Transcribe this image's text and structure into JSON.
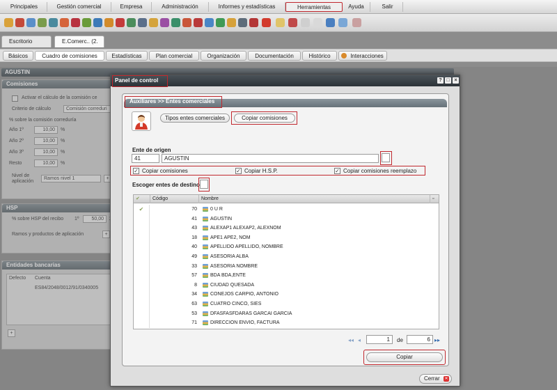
{
  "menu": {
    "items": [
      "Principales",
      "Gestión comercial",
      "Empresa",
      "Administración",
      "Informes y estadísticas",
      "Herramientas",
      "Ayuda",
      "Salir"
    ],
    "highlighted": "Herramientas"
  },
  "toolbar": {
    "icon_count": 31
  },
  "doc_tabs": [
    {
      "label": "Escritorio"
    },
    {
      "label": "E.Comerc.. (2."
    }
  ],
  "sub_tabs": [
    "Básicos",
    "Cuadro de comisiones",
    "Estadísticas",
    "Plan comercial",
    "Organización",
    "Documentación",
    "Histórico",
    "Interacciones"
  ],
  "background": {
    "entity_name": "AGUSTIN",
    "comisiones": {
      "title": "Comisiones",
      "activar_label": "Activar el cálculo de la comisión ce",
      "criterio_label": "Criterio de cálculo",
      "criterio_value": "Comisión correduri",
      "pct_label": "% sobre la comisión correduría",
      "years": [
        {
          "label": "Año 1º",
          "value": "10,00",
          "unit": "%"
        },
        {
          "label": "Año 2º",
          "value": "10,00",
          "unit": "%"
        },
        {
          "label": "Año 3º",
          "value": "10,00",
          "unit": "%"
        },
        {
          "label": "Resto",
          "value": "10,00",
          "unit": "%"
        }
      ],
      "nivel_label_1": "Nivel de",
      "nivel_label_2": "aplicación",
      "nivel_value": "Ramos nivel 1"
    },
    "hsp": {
      "title": "HSP",
      "pct_label": "% sobre HSP del recibo",
      "first_label": "1º",
      "first_value": "50,00",
      "second_label": "2",
      "ramos_label": "Ramos y productos de aplicación"
    },
    "bancos": {
      "title": "Entidades bancarias",
      "col_defecto": "Defecto",
      "col_cuenta": "Cuenta",
      "account": "ES84/2048/0012/91/0340005"
    }
  },
  "modal": {
    "title": "Panel de control",
    "breadcrumb": "Auxiliares >> Entes comerciales",
    "tabs": [
      "Tipos entes comerciales",
      "Copiar comisiones"
    ],
    "active_tab": "Copiar comisiones",
    "origen_label": "Ente de origen",
    "origen_code": "41",
    "origen_name": "AGUSTIN",
    "options": [
      {
        "label": "Copiar comisiones",
        "checked": true
      },
      {
        "label": "Copiar H.S.P.",
        "checked": true
      },
      {
        "label": "Copiar comisiones reemplazo",
        "checked": true
      }
    ],
    "destino_label": "Escoger entes de destino",
    "grid": {
      "col_code": "Código",
      "col_name": "Nombre",
      "rows": [
        {
          "code": "70",
          "name": "0 U R",
          "selected": true
        },
        {
          "code": "41",
          "name": "AGUSTIN",
          "selected": false
        },
        {
          "code": "43",
          "name": "ALEXAP1 ALEXAP2, ALEXNOM",
          "selected": false
        },
        {
          "code": "18",
          "name": "APE1 APE2, NOM",
          "selected": false
        },
        {
          "code": "40",
          "name": "APELLIDO APELLIDO, NOMBRE",
          "selected": false
        },
        {
          "code": "49",
          "name": "ASESORIA ALBA",
          "selected": false
        },
        {
          "code": "33",
          "name": "ASESORIA NOMBRE",
          "selected": false
        },
        {
          "code": "57",
          "name": "BDA BDA,ENTE",
          "selected": false
        },
        {
          "code": "8",
          "name": "CIUDAD QUESADA",
          "selected": false
        },
        {
          "code": "34",
          "name": "CONEJOS CARPIO, ANTONIO",
          "selected": false
        },
        {
          "code": "63",
          "name": "CUATRO CINCO, SIES",
          "selected": false
        },
        {
          "code": "53",
          "name": "DFASFASFDARAS GARCAI GARCIA",
          "selected": false
        },
        {
          "code": "71",
          "name": "DIRECCION ENVIO, FACTURA",
          "selected": false
        }
      ]
    },
    "pager": {
      "current": "1",
      "of_label": "de",
      "total": "6"
    },
    "copy_button": "Copiar",
    "close_button": "Cerrar"
  }
}
